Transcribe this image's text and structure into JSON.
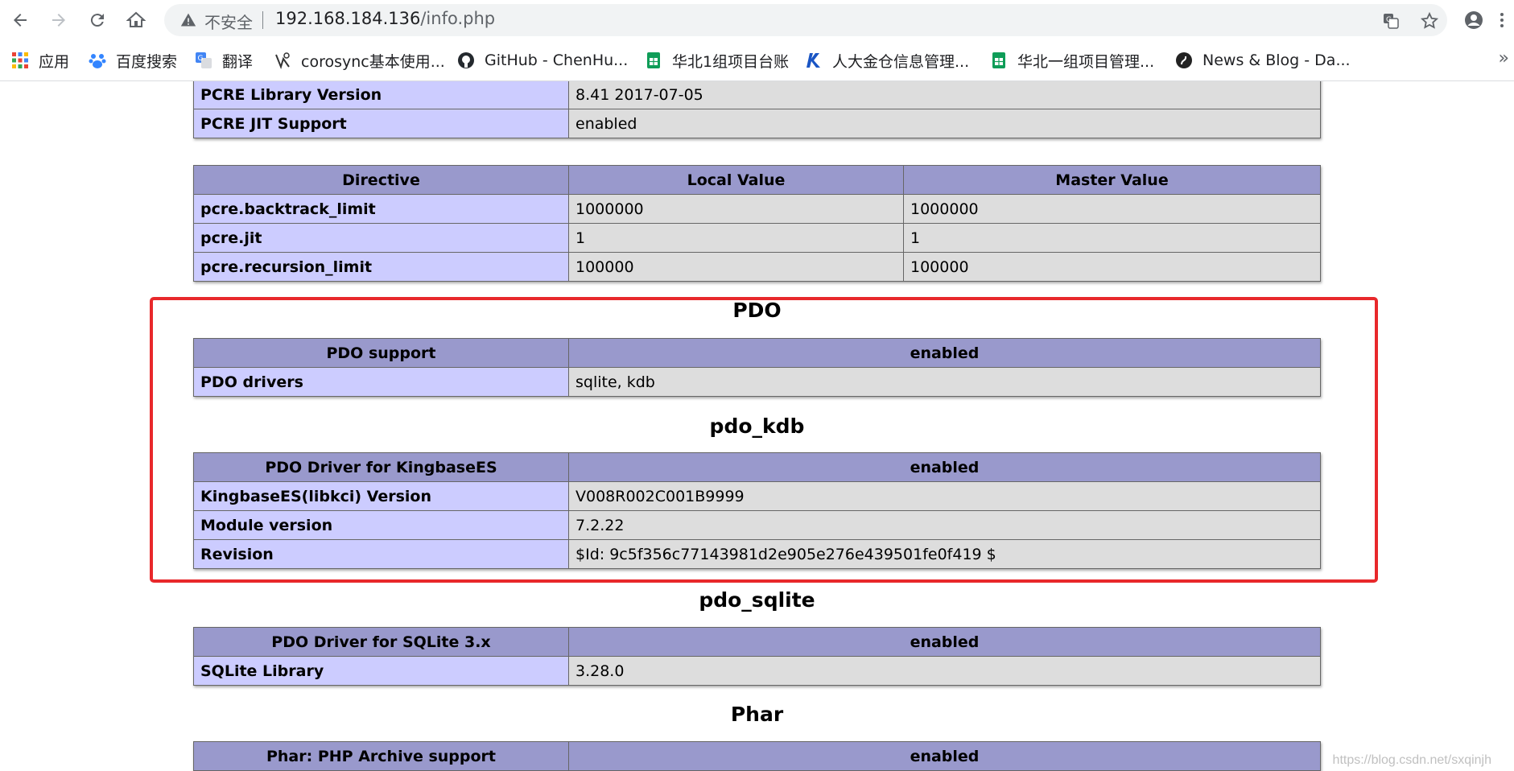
{
  "browser": {
    "insecure_label": "不安全",
    "url_host": "192.168.184.136",
    "url_path": "/info.php",
    "bookmarks": [
      {
        "label": "应用",
        "icon": "apps-grid-icon"
      },
      {
        "label": "百度搜索",
        "icon": "baidu-paw-icon"
      },
      {
        "label": "翻译",
        "icon": "translate-icon"
      },
      {
        "label": "corosync基本使用...",
        "icon": "bookmark-site-icon"
      },
      {
        "label": "GitHub - ChenHu...",
        "icon": "github-icon"
      },
      {
        "label": "华北1组项目台账",
        "icon": "sheets-icon"
      },
      {
        "label": "人大金仓信息管理...",
        "icon": "kingbase-icon"
      },
      {
        "label": "华北一组项目管理...",
        "icon": "sheets-icon"
      },
      {
        "label": "News & Blog - Da...",
        "icon": "news-icon"
      }
    ],
    "bookmarks_more": "»"
  },
  "pcre_table": {
    "rows": [
      {
        "name": "PCRE Library Version",
        "value": "8.41 2017-07-05"
      },
      {
        "name": "PCRE JIT Support",
        "value": "enabled"
      }
    ]
  },
  "pcre_directives": {
    "headers": [
      "Directive",
      "Local Value",
      "Master Value"
    ],
    "rows": [
      {
        "name": "pcre.backtrack_limit",
        "local": "1000000",
        "master": "1000000"
      },
      {
        "name": "pcre.jit",
        "local": "1",
        "master": "1"
      },
      {
        "name": "pcre.recursion_limit",
        "local": "100000",
        "master": "100000"
      }
    ]
  },
  "pdo": {
    "title": "PDO",
    "header": {
      "name": "PDO support",
      "value": "enabled"
    },
    "rows": [
      {
        "name": "PDO drivers",
        "value": "sqlite, kdb"
      }
    ]
  },
  "pdo_kdb": {
    "title": "pdo_kdb",
    "header": {
      "name": "PDO Driver for KingbaseES",
      "value": "enabled"
    },
    "rows": [
      {
        "name": "KingbaseES(libkci) Version",
        "value": "V008R002C001B9999"
      },
      {
        "name": "Module version",
        "value": "7.2.22"
      },
      {
        "name": "Revision",
        "value": "$Id: 9c5f356c77143981d2e905e276e439501fe0f419 $"
      }
    ]
  },
  "pdo_sqlite": {
    "title": "pdo_sqlite",
    "header": {
      "name": "PDO Driver for SQLite 3.x",
      "value": "enabled"
    },
    "rows": [
      {
        "name": "SQLite Library",
        "value": "3.28.0"
      }
    ]
  },
  "phar": {
    "title": "Phar",
    "header": {
      "name": "Phar: PHP Archive support",
      "value": "enabled"
    }
  },
  "watermark": "https://blog.csdn.net/sxqinjh",
  "colors": {
    "header_bg": "#9999cc",
    "label_bg": "#ccccff",
    "value_bg": "#dddddd",
    "highlight_border": "#e8282b"
  }
}
